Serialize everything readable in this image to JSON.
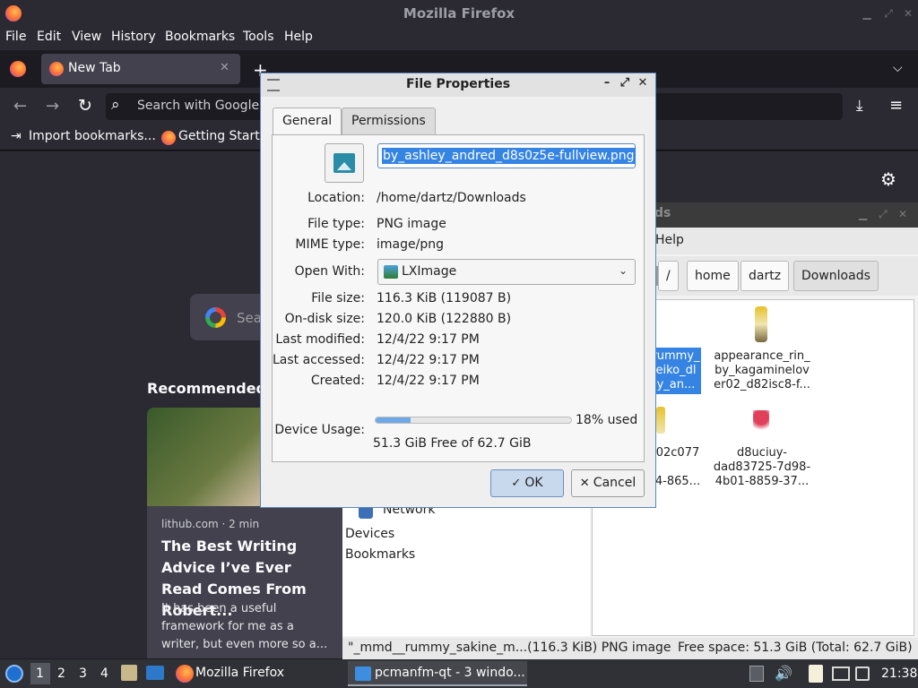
{
  "firefox": {
    "window_title": "Mozilla Firefox",
    "menu": [
      "File",
      "Edit",
      "View",
      "History",
      "Bookmarks",
      "Tools",
      "Help"
    ],
    "tab_label": "New Tab",
    "url_placeholder": "Search with Google",
    "bookmarks": [
      "Import bookmarks...",
      "Getting Starte"
    ],
    "google_search_partial": "Sea",
    "recommended_partial": "Recommended b",
    "card": {
      "source": "lithub.com · 2 min",
      "title": "The Best Writing Advice I’ve Ever Read Comes From Robert...",
      "excerpt": "It has been a useful framework for me as a writer, but even more so a..."
    }
  },
  "filemanager": {
    "title_partial": "ds",
    "menu_partial": "Help",
    "path": [
      "/",
      "home",
      "dartz",
      "Downloads"
    ],
    "side_items": [
      "Network",
      "Devices",
      "Bookmarks"
    ],
    "files": [
      {
        "label_lines": [
          "rummy_",
          "eiko_dl",
          "y_an..."
        ],
        "selected": true
      },
      {
        "label_lines": [
          "appearance_rin_",
          "by_kagaminelov",
          "er02_d82isc8-f..."
        ]
      },
      {
        "label_lines": [
          "02c077",
          "",
          "4-865..."
        ]
      },
      {
        "label_lines": [
          "d8uciuy-",
          "dad83725-7d98-",
          "4b01-8859-37..."
        ]
      }
    ],
    "status_left": "\"_mmd__rummy_sakine_m...(116.3 KiB) PNG image",
    "status_right": "Free space: 51.3 GiB (Total: 62.7 GiB)"
  },
  "dialog": {
    "title": "File Properties",
    "tabs": [
      "General",
      "Permissions"
    ],
    "filename": "by_ashley_andred_d8s0z5e-fullview.png",
    "location_label": "Location:",
    "location": "/home/dartz/Downloads",
    "file_type_label": "File type:",
    "file_type": "PNG image",
    "mime_label": "MIME type:",
    "mime": "image/png",
    "open_with_label": "Open With:",
    "open_with": "LXImage",
    "file_size_label": "File size:",
    "file_size": "116.3 KiB (119087 B)",
    "ondisk_label": "On-disk size:",
    "ondisk": "120.0 KiB (122880 B)",
    "modified_label": "Last modified:",
    "modified": "12/4/22 9:17 PM",
    "accessed_label": "Last accessed:",
    "accessed": "12/4/22 9:17 PM",
    "created_label": "Created:",
    "created": "12/4/22 9:17 PM",
    "device_usage_label": "Device Usage:",
    "usage_percent": 18,
    "usage_text": "18% used",
    "free_text": "51.3 GiB Free of 62.7 GiB",
    "ok_label": "OK",
    "cancel_label": "Cancel"
  },
  "taskbar": {
    "desktops": [
      "1",
      "2",
      "3",
      "4"
    ],
    "task_firefox": "Mozilla Firefox",
    "task_fm": "pcmanfm-qt - 3 windo...",
    "clock": "21:38"
  },
  "colors": {
    "selection": "#3584e4",
    "usage_fill": "#6fa8e6",
    "ff_bg": "#2b2a33"
  }
}
